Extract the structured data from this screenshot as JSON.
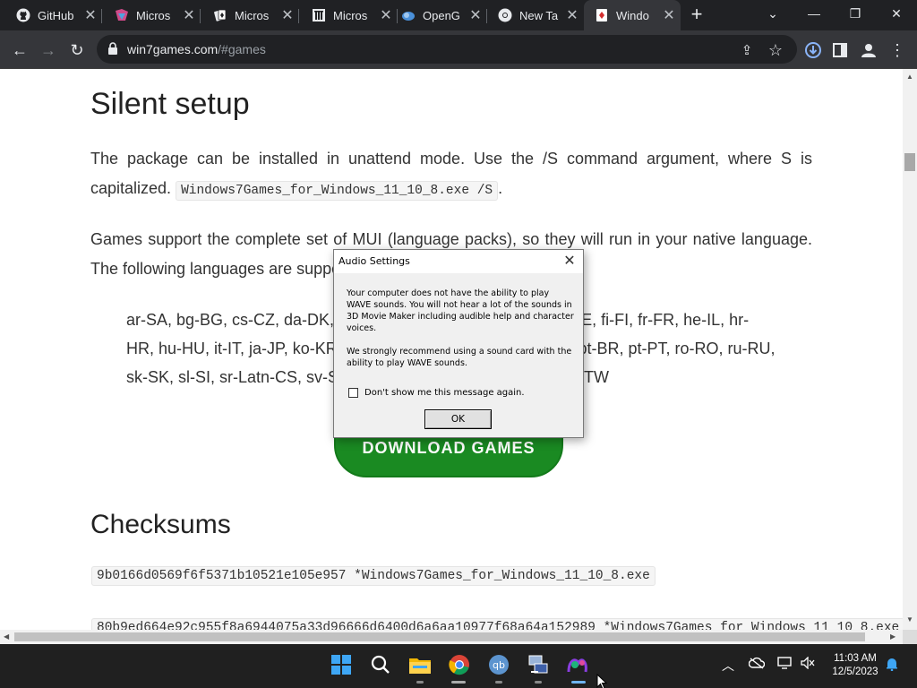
{
  "browser": {
    "tabs": [
      {
        "label": "GitHub",
        "icon": "github-icon",
        "active": false
      },
      {
        "label": "Micros",
        "icon": "microsoft-icon",
        "active": false
      },
      {
        "label": "Micros",
        "icon": "solitaire-icon",
        "active": false
      },
      {
        "label": "Micros",
        "icon": "microsoft-learn-icon",
        "active": false
      },
      {
        "label": "OpenG",
        "icon": "openg-icon",
        "active": false
      },
      {
        "label": "New Ta",
        "icon": "chrome-icon",
        "active": false
      },
      {
        "label": "Windo",
        "icon": "windows-games-icon",
        "active": true
      }
    ],
    "url_host": "win7games.com",
    "url_path": "/#games"
  },
  "page": {
    "silent_heading": "Silent setup",
    "silent_text": "The package can be installed in unattend mode. Use the /S command argument, where S is capitalized.",
    "silent_command": "Windows7Games_for_Windows_11_10_8.exe /S",
    "silent_after": ".",
    "languages_intro": "Games support the complete set of MUI (language packs), so they will run in your native language. The following languages are supported:",
    "languages_line1": "ar-SA, bg-BG, cs-CZ, da-DK, de-DE, el-GR, en-US, es-ES, et-EE, fi-FI, fr-FR, he-IL, hr-",
    "languages_line2": "HR, hu-HU, it-IT, ja-JP, ko-KR, lt-LT, lv-LV, nb-NO, nl-NL, pl-PL, pt-BR, pt-PT, ro-RO, ru-RU,",
    "languages_line3": "sk-SK, sl-SI, sr-Latn-CS, sv-SE, th-TH, tr-TR, uk-UA, zh-CN, zh-TW",
    "download_label": "DOWNLOAD GAMES",
    "checksums_heading": "Checksums",
    "checksum1": "9b0166d0569f6f5371b10521e105e957 *Windows7Games_for_Windows_11_10_8.exe",
    "checksum2": "80b9ed664e92c955f8a6944075a33d96666d6400d6a6aa10977f68a64a152989 *Windows7Games_for_Windows_11_10_8.exe"
  },
  "dialog": {
    "title": "Audio Settings",
    "message1": "Your computer does not have the ability to play WAVE sounds.  You will not hear a lot of the sounds in 3D Movie Maker including audible help and character voices.",
    "message2": "We strongly recommend using a sound card with the ability to play WAVE sounds.",
    "checkbox_label": "Don't show me this message again.",
    "checkbox_checked": false,
    "ok_label": "OK"
  },
  "taskbar": {
    "time": "11:03 AM",
    "date": "12/5/2023",
    "apps": [
      "windows-start-icon",
      "search-icon",
      "file-explorer-icon",
      "chrome-icon",
      "qbittorrent-icon",
      "network-tool-icon",
      "3d-movie-maker-icon"
    ]
  },
  "colors": {
    "download_green": "#1a8a22",
    "tabstrip": "#202124",
    "toolbar": "#35363a"
  }
}
